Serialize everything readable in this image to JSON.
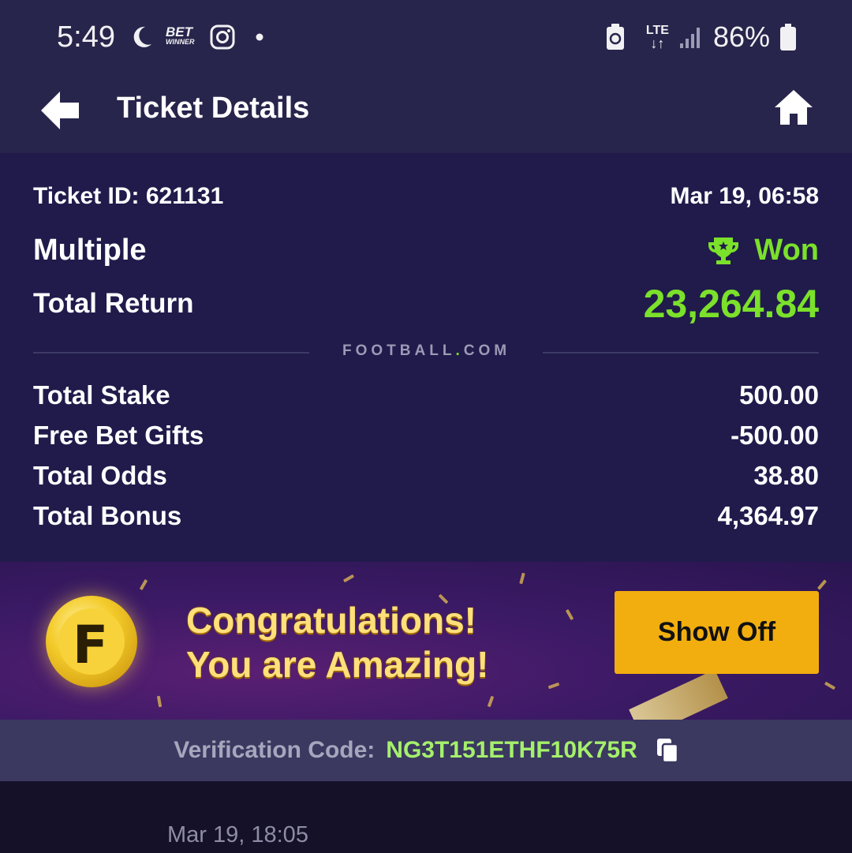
{
  "status_bar": {
    "time": "5:49",
    "network": "LTE",
    "battery_pct": "86%",
    "betwinner_top": "BET",
    "betwinner_bottom": "WINNER"
  },
  "header": {
    "title": "Ticket Details"
  },
  "ticket": {
    "id_label": "Ticket ID: 621131",
    "datetime": "Mar 19, 06:58",
    "type": "Multiple",
    "status": "Won",
    "total_return_label": "Total Return",
    "total_return_value": "23,264.84",
    "divider_brand_main": "FOOTBALL",
    "divider_brand_dot": ".",
    "divider_brand_tail": "COM",
    "rows": [
      {
        "label": "Total Stake",
        "value": "500.00"
      },
      {
        "label": "Free Bet Gifts",
        "value": "-500.00"
      },
      {
        "label": "Total Odds",
        "value": "38.80"
      },
      {
        "label": "Total Bonus",
        "value": "4,364.97"
      }
    ]
  },
  "banner": {
    "line1": "Congratulations!",
    "line2": "You are Amazing!",
    "coin_letter": "F",
    "button_label": "Show Off"
  },
  "verification": {
    "label": "Verification Code:",
    "code": "NG3T151ETHF10K75R"
  },
  "next_ticket": {
    "datetime": "Mar 19, 18:05"
  },
  "colors": {
    "accent_green": "#7be12a",
    "button_gold": "#f2ae0f",
    "header_bg": "#27254b",
    "card_bg": "#201b4b"
  }
}
